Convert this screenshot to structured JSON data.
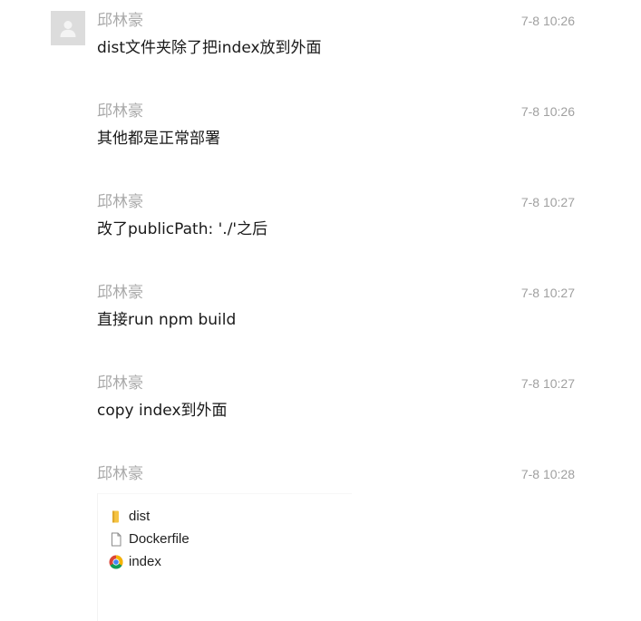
{
  "messages": [
    {
      "sender": "邱林豪",
      "time": "7-8 10:26",
      "text": "dist文件夹除了把index放到外面"
    },
    {
      "sender": "邱林豪",
      "time": "7-8 10:26",
      "text": "其他都是正常部署"
    },
    {
      "sender": "邱林豪",
      "time": "7-8 10:27",
      "text": "改了publicPath: './'之后"
    },
    {
      "sender": "邱林豪",
      "time": "7-8 10:27",
      "text": "直接run npm build"
    },
    {
      "sender": "邱林豪",
      "time": "7-8 10:27",
      "text": "copy index到外面"
    },
    {
      "sender": "邱林豪",
      "time": "7-8 10:28",
      "text": ""
    }
  ],
  "attachment": {
    "files": [
      {
        "name": "dist",
        "icon": "folder-icon"
      },
      {
        "name": "Dockerfile",
        "icon": "file-icon"
      },
      {
        "name": "index",
        "icon": "chrome-icon"
      }
    ]
  },
  "colors": {
    "sender": "#a9a9a9",
    "time": "#a0a0a0",
    "text": "#1a1a1a",
    "avatar_bg": "#dcdcdc",
    "folder": "#f5c342"
  }
}
